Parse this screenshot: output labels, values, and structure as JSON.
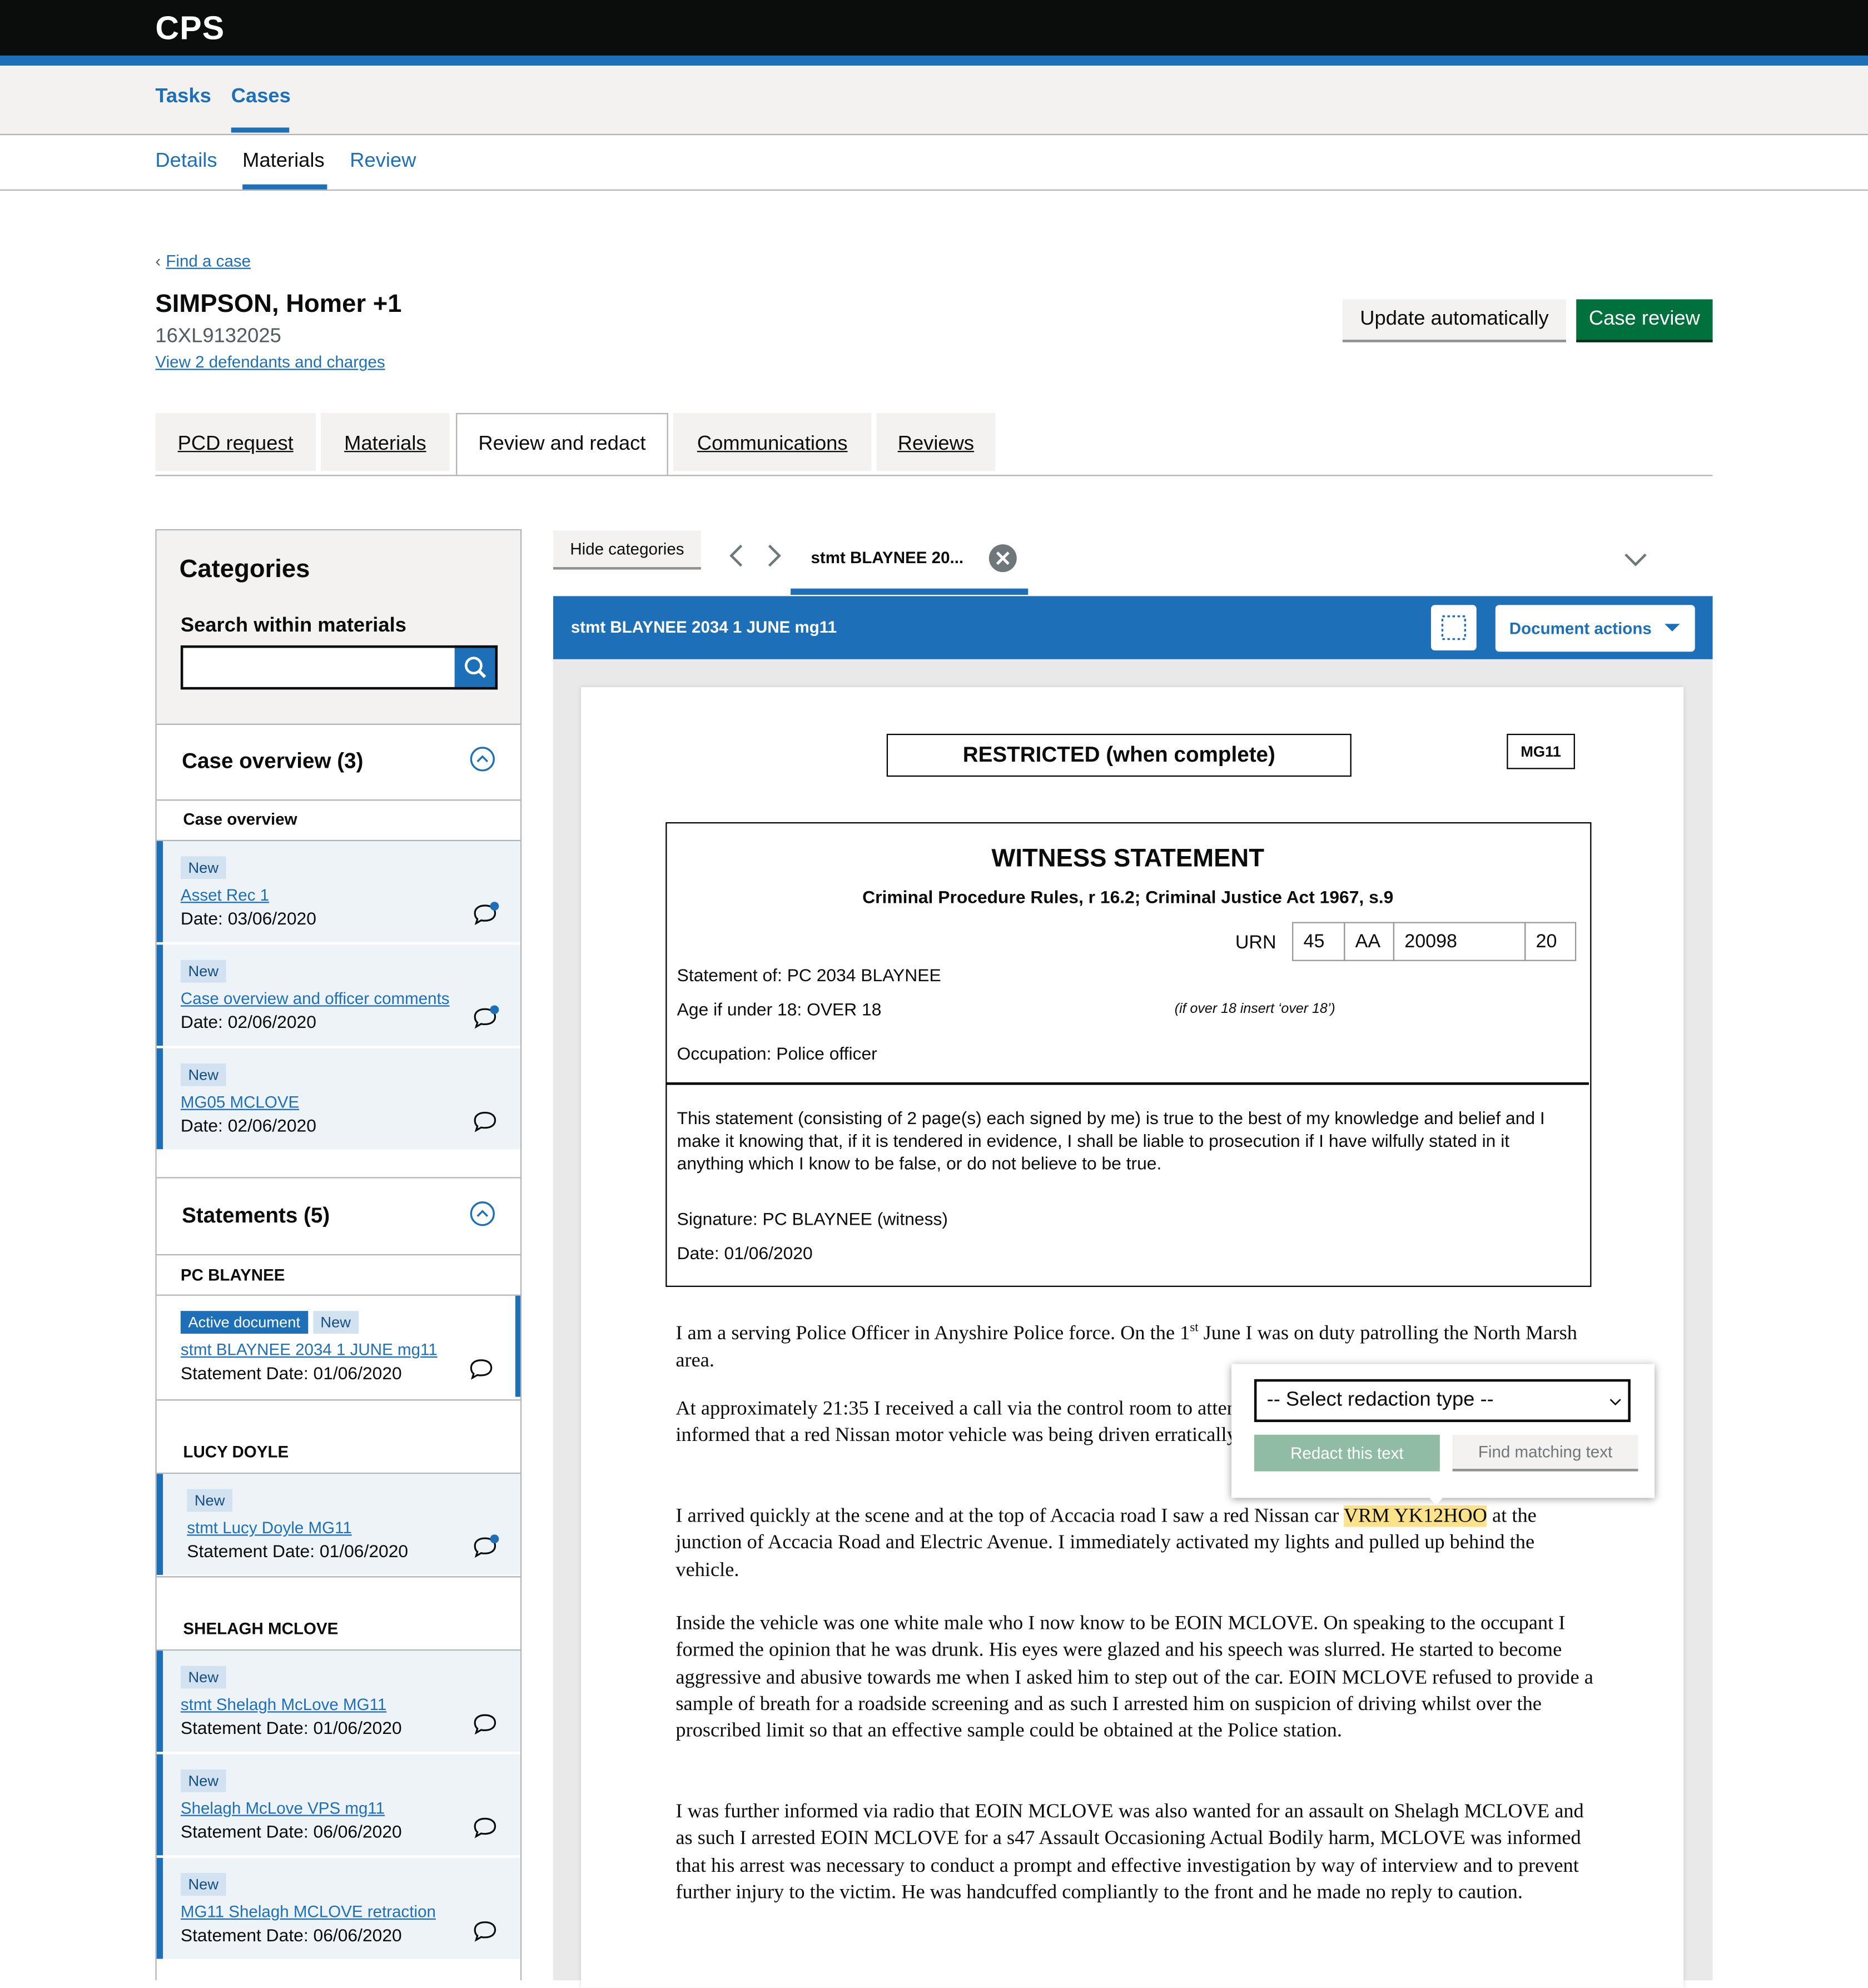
{
  "header": {
    "brand": "CPS"
  },
  "nav_primary": {
    "tasks": "Tasks",
    "cases": "Cases"
  },
  "nav_secondary": {
    "details": "Details",
    "materials": "Materials",
    "review": "Review"
  },
  "case": {
    "back_link": "Find a case",
    "title": "SIMPSON, Homer +1",
    "urn": "16XL9132025",
    "view_defendants": "View 2 defendants and charges",
    "update_button": "Update automatically",
    "review_button": "Case review"
  },
  "tabs": [
    "PCD request",
    "Materials",
    "Review and redact",
    "Communications",
    "Reviews"
  ],
  "sidebar": {
    "title": "Categories",
    "search_label": "Search within materials",
    "search_value": "",
    "sections": [
      {
        "title": "Case overview (3)",
        "groups": [
          {
            "name": "Case overview",
            "items": [
              {
                "tags": [
                  "New"
                ],
                "link": "Asset Rec 1",
                "date": "Date: 03/06/2020",
                "has_new_comment": true
              },
              {
                "tags": [
                  "New"
                ],
                "link": "Case overview and officer comments",
                "date": "Date: 02/06/2020",
                "has_new_comment": true
              },
              {
                "tags": [
                  "New"
                ],
                "link": "MG05 MCLOVE",
                "date": "Date: 02/06/2020",
                "has_new_comment": false
              }
            ]
          }
        ]
      },
      {
        "title": "Statements (5)",
        "groups": [
          {
            "name": "PC BLAYNEE",
            "items": [
              {
                "tags": [
                  "Active document",
                  "New"
                ],
                "link": "stmt BLAYNEE 2034 1 JUNE mg11",
                "date": "Statement Date: 01/06/2020",
                "has_new_comment": false
              }
            ]
          },
          {
            "name": "LUCY DOYLE",
            "items": [
              {
                "tags": [
                  "New"
                ],
                "link": "stmt Lucy Doyle MG11",
                "date": "Statement Date: 01/06/2020",
                "has_new_comment": true
              }
            ]
          },
          {
            "name": "SHELAGH MCLOVE",
            "items": [
              {
                "tags": [
                  "New"
                ],
                "link": "stmt Shelagh McLove MG11",
                "date": "Statement Date: 01/06/2020",
                "has_new_comment": false
              },
              {
                "tags": [
                  "New"
                ],
                "link": "Shelagh McLove VPS mg11",
                "date": "Statement Date: 06/06/2020",
                "has_new_comment": false
              },
              {
                "tags": [
                  "New"
                ],
                "link": "MG11 Shelagh MCLOVE retraction",
                "date": "Statement Date: 06/06/2020",
                "has_new_comment": false
              }
            ]
          }
        ]
      }
    ]
  },
  "viewer": {
    "hide_categories": "Hide categories",
    "open_tab": "stmt BLAYNEE 20...",
    "doc_title": "stmt BLAYNEE 2034 1 JUNE mg11",
    "document_actions": "Document actions",
    "colors": {
      "accent": "#1d70b8",
      "highlight": "#fce28a",
      "green": "#00703c"
    }
  },
  "document": {
    "restricted": "RESTRICTED (when complete)",
    "form_code": "MG11",
    "heading": "WITNESS STATEMENT",
    "subheading": "Criminal Procedure Rules, r 16.2; Criminal Justice Act 1967, s.9",
    "urn_label": "URN",
    "urn_parts": [
      "45",
      "AA",
      "20098",
      "20"
    ],
    "statement_of": "Statement of: PC 2034 BLAYNEE",
    "age": "Age if under 18: OVER 18",
    "age_hint": "(if over 18 insert ‘over 18’)",
    "occupation": "Occupation:  Police officer",
    "declaration": "This statement (consisting of 2 page(s) each signed by me) is true to the best of my knowledge and belief and I make it knowing that, if it is tendered in evidence, I shall be liable to prosecution if I have wilfully stated in it anything which I know to be false, or do not believe to be true.",
    "signature": "Signature: PC BLAYNEE (witness)",
    "date": "Date:  01/06/2020",
    "p1_a": "I am a serving Police Officer in Anyshire Police force. On the 1",
    "p1_sup": "st",
    "p1_b": " June I was on duty patrolling the North Marsh area.",
    "p2": "At approximately 21:35 I received a call via the control room to attend an address in the North Marsh area. I was informed that a red Nissan motor vehicle was being driven erratically and that the driver may be drunk.",
    "p3_a": "I arrived quickly at the scene and at the top of Accacia road I saw a red Nissan car ",
    "p3_hl": "VRM YK12HOO",
    "p3_b": " at the junction of Accacia Road and Electric Avenue. I immediately activated my lights and pulled up behind the vehicle.",
    "p4": "Inside the vehicle was one white male who I now know to be EOIN MCLOVE. On speaking to the occupant I formed the opinion that he was drunk. His eyes were glazed and his speech was slurred. He started to become aggressive and abusive towards me when I asked him to step out of the car. EOIN MCLOVE refused to provide a sample of breath for a roadside screening and as such I arrested him on suspicion of driving whilst over the proscribed limit so that an effective sample could be obtained at the Police station.",
    "p5": "I was further informed via radio that EOIN MCLOVE was also wanted for an assault on Shelagh MCLOVE and as such I arrested EOIN MCLOVE for a s47 Assault Occasioning Actual Bodily harm, MCLOVE was informed that his arrest was necessary to conduct a prompt and effective investigation by way of interview and to prevent further injury to the victim. He was handcuffed compliantly to the front and he made no reply to caution."
  },
  "redaction_popup": {
    "select_placeholder": "-- Select redaction type --",
    "redact_button": "Redact this text",
    "find_button": "Find matching text"
  }
}
